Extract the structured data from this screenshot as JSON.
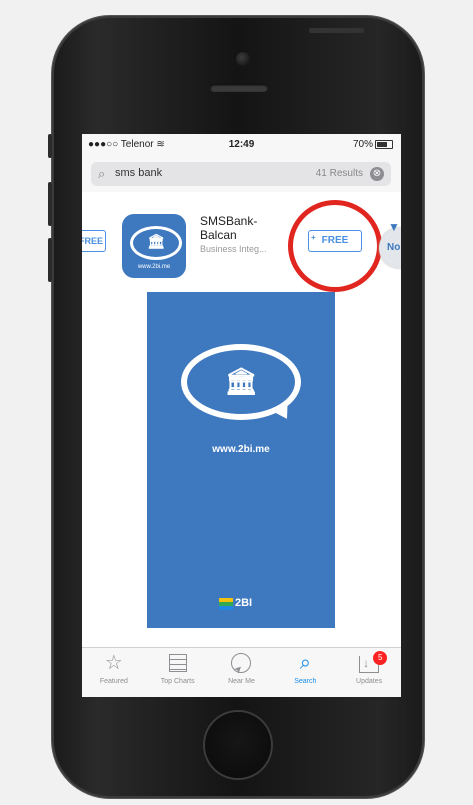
{
  "status_bar": {
    "carrier": "●●●○○ Telenor",
    "wifi": "wifi-icon",
    "time": "12:49",
    "battery": "70%"
  },
  "search": {
    "query": "sms bank",
    "results": "41 Results",
    "clear": "⊗"
  },
  "prev_app": {
    "button": "FREE"
  },
  "app": {
    "name": "SMSBank-\nBalcan",
    "category": "Business Integ...",
    "icon_url": "www.2bi.me",
    "button": "FREE",
    "button_plus": "+"
  },
  "next_app": {
    "peek": "No"
  },
  "screenshot": {
    "url": "www.2bi.me",
    "logo": "2BI"
  },
  "tabs": [
    {
      "label": "Featured",
      "icon": "star-icon"
    },
    {
      "label": "Top Charts",
      "icon": "list-icon"
    },
    {
      "label": "Near Me",
      "icon": "location-icon"
    },
    {
      "label": "Search",
      "icon": "search-icon"
    },
    {
      "label": "Updates",
      "icon": "updates-icon",
      "badge": "5"
    }
  ],
  "colors": {
    "accent": "#1a8ce8",
    "app_blue": "#3e79bf",
    "highlight": "#e0261f"
  }
}
